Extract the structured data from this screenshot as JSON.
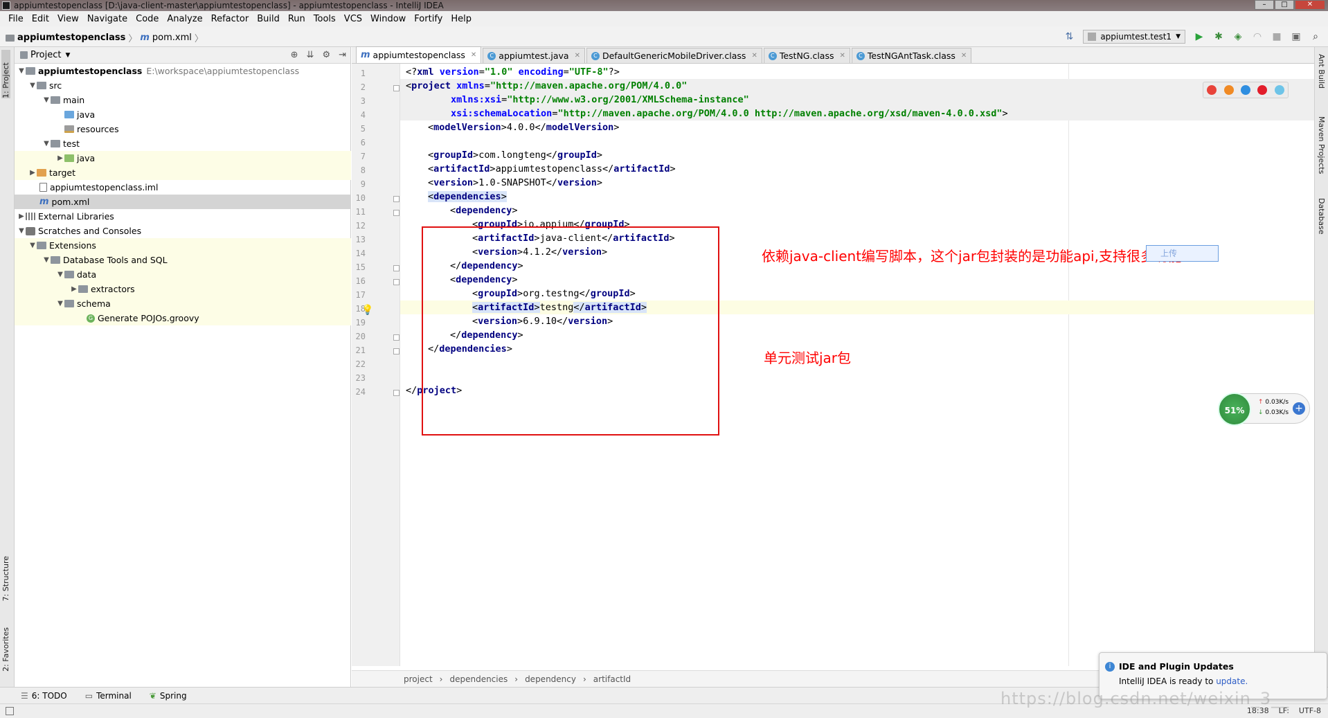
{
  "window": {
    "title": "appiumtestopenclass [D:\\java-client-master\\appiumtestopenclass] - appiumtestopenclass - IntelliJ IDEA"
  },
  "menu": [
    "File",
    "Edit",
    "View",
    "Navigate",
    "Code",
    "Analyze",
    "Refactor",
    "Build",
    "Run",
    "Tools",
    "VCS",
    "Window",
    "Fortify",
    "Help"
  ],
  "breadcrumb": {
    "project": "appiumtestopenclass",
    "file": "pom.xml"
  },
  "run_config": "appiumtest.test1",
  "project_panel": {
    "title": "Project",
    "tree": [
      {
        "label": "appiumtestopenclass",
        "extra": "E:\\workspace\\appiumtestopenclass"
      },
      {
        "label": "src"
      },
      {
        "label": "main"
      },
      {
        "label": "java"
      },
      {
        "label": "resources"
      },
      {
        "label": "test"
      },
      {
        "label": "java"
      },
      {
        "label": "target"
      },
      {
        "label": "appiumtestopenclass.iml"
      },
      {
        "label": "pom.xml"
      },
      {
        "label": "External Libraries"
      },
      {
        "label": "Scratches and Consoles"
      },
      {
        "label": "Extensions"
      },
      {
        "label": "Database Tools and SQL"
      },
      {
        "label": "data"
      },
      {
        "label": "extractors"
      },
      {
        "label": "schema"
      },
      {
        "label": "Generate POJOs.groovy"
      }
    ]
  },
  "tool_windows": {
    "left": [
      "1: Project",
      "7: Structure",
      "2: Favorites"
    ],
    "right": [
      "Ant Build",
      "Maven Projects",
      "Database"
    ],
    "bottom": [
      "6: TODO",
      "Terminal",
      "Spring"
    ]
  },
  "tabs": [
    "appiumtestopenclass",
    "appiumtest.java",
    "DefaultGenericMobileDriver.class",
    "TestNG.class",
    "TestNGAntTask.class"
  ],
  "line_numbers": [
    "1",
    "2",
    "3",
    "4",
    "5",
    "6",
    "7",
    "8",
    "9",
    "10",
    "11",
    "12",
    "13",
    "14",
    "15",
    "16",
    "17",
    "18",
    "19",
    "20",
    "21",
    "22",
    "23",
    "24"
  ],
  "code": {
    "l1": {
      "open": "<?",
      "tag": "xml",
      "a1": " version",
      "e1": "=",
      "v1": "\"1.0\"",
      "a2": " encoding",
      "e2": "=",
      "v2": "\"UTF-8\"",
      "close": "?>"
    },
    "l2": {
      "open": "<",
      "tag": "project",
      "a1": " xmlns",
      "e1": "=",
      "v1": "\"http://maven.apache.org/POM/4.0.0\""
    },
    "l3": {
      "a1": "xmlns:xsi",
      "e1": "=",
      "v1": "\"http://www.w3.org/2001/XMLSchema-instance\""
    },
    "l4": {
      "a1": "xsi:schemaLocation",
      "e1": "=",
      "v1": "\"http://maven.apache.org/POM/4.0.0 http://maven.apache.org/xsd/maven-4.0.0.xsd\"",
      "close": ">"
    },
    "l5": {
      "tag": "modelVersion",
      "text": "4.0.0"
    },
    "l7": {
      "tag": "groupId",
      "text": "com.longteng"
    },
    "l8": {
      "tag": "artifactId",
      "text": "appiumtestopenclass"
    },
    "l9": {
      "tag": "version",
      "text": "1.0-SNAPSHOT"
    },
    "l10": {
      "tag": "dependencies"
    },
    "l11": {
      "tag": "dependency"
    },
    "l12": {
      "tag": "groupId",
      "text": "io.appium"
    },
    "l13": {
      "tag": "artifactId",
      "text": "java-client"
    },
    "l14": {
      "tag": "version",
      "text": "4.1.2"
    },
    "l15": {
      "tag": "dependency"
    },
    "l16": {
      "tag": "dependency"
    },
    "l17": {
      "tag": "groupId",
      "text": "org.testng"
    },
    "l18": {
      "tag": "artifactId",
      "text": "testng"
    },
    "l19": {
      "tag": "version",
      "text": "6.9.10"
    },
    "l20": {
      "tag": "dependency"
    },
    "l21": {
      "tag": "dependencies"
    },
    "l24": {
      "tag": "project"
    }
  },
  "annotations": {
    "note1": "依赖java-client编写脚本，这个jar包封装的是功能api,支持很多功能",
    "note2": "单元测试jar包",
    "upload": "上传"
  },
  "editor_breadcrumb": [
    "project",
    "dependencies",
    "dependency",
    "artifactId"
  ],
  "net_widget": {
    "percent": "51%",
    "up": "0.03K/s",
    "down": "0.03K/s"
  },
  "notification": {
    "title": "IDE and Plugin Updates",
    "body": "IntelliJ IDEA is ready to ",
    "link": "update."
  },
  "status": {
    "pos": "18:38",
    "lf": "LF:",
    "enc": "UTF-8"
  },
  "watermark": "https://blog.csdn.net/weixin_3__"
}
